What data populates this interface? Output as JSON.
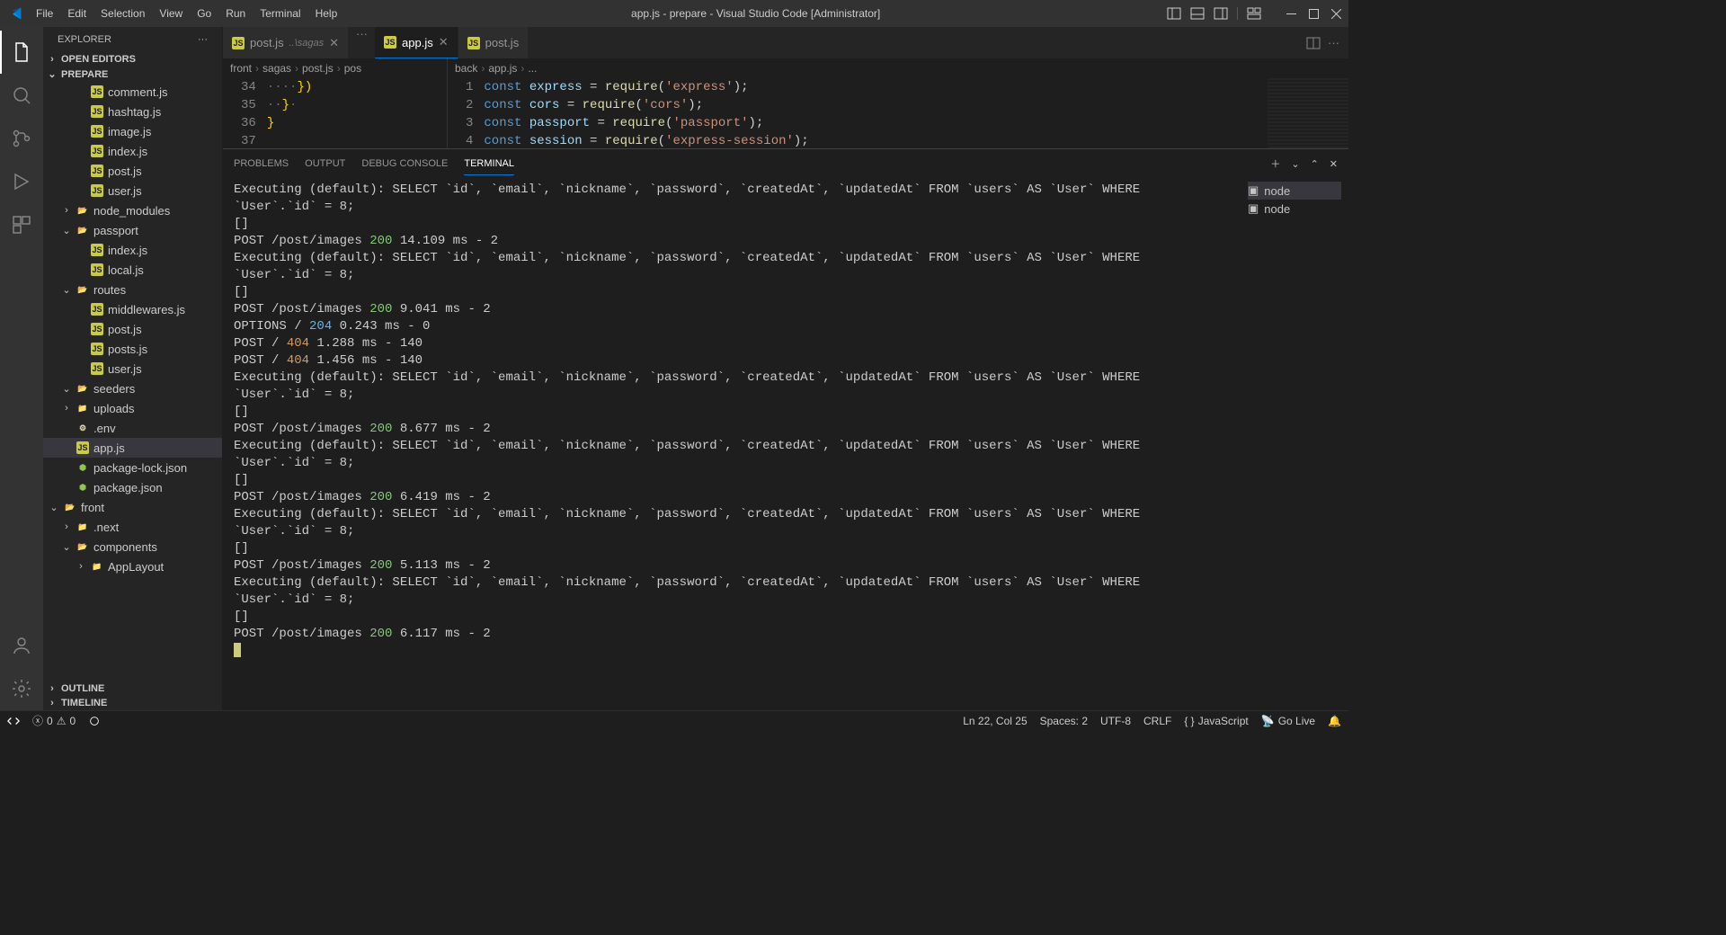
{
  "titlebar": {
    "menu": [
      "File",
      "Edit",
      "Selection",
      "View",
      "Go",
      "Run",
      "Terminal",
      "Help"
    ],
    "title": "app.js - prepare - Visual Studio Code [Administrator]"
  },
  "sidebar": {
    "header": "EXPLORER",
    "openEditors": "OPEN EDITORS",
    "workspace": "PREPARE",
    "files": [
      {
        "name": "comment.js",
        "kind": "js",
        "indent": 2
      },
      {
        "name": "hashtag.js",
        "kind": "js",
        "indent": 2
      },
      {
        "name": "image.js",
        "kind": "js",
        "indent": 2
      },
      {
        "name": "index.js",
        "kind": "js",
        "indent": 2
      },
      {
        "name": "post.js",
        "kind": "js",
        "indent": 2
      },
      {
        "name": "user.js",
        "kind": "js",
        "indent": 2
      },
      {
        "name": "node_modules",
        "kind": "folder-green",
        "indent": 1,
        "chev": "›"
      },
      {
        "name": "passport",
        "kind": "folder-open",
        "indent": 1,
        "chev": "⌄"
      },
      {
        "name": "index.js",
        "kind": "js",
        "indent": 2
      },
      {
        "name": "local.js",
        "kind": "js",
        "indent": 2
      },
      {
        "name": "routes",
        "kind": "folder-green",
        "indent": 1,
        "chev": "⌄"
      },
      {
        "name": "middlewares.js",
        "kind": "js",
        "indent": 2
      },
      {
        "name": "post.js",
        "kind": "js",
        "indent": 2
      },
      {
        "name": "posts.js",
        "kind": "js",
        "indent": 2
      },
      {
        "name": "user.js",
        "kind": "js",
        "indent": 2
      },
      {
        "name": "seeders",
        "kind": "folder-open",
        "indent": 1,
        "chev": "⌄"
      },
      {
        "name": "uploads",
        "kind": "folder",
        "indent": 1,
        "chev": "›"
      },
      {
        "name": ".env",
        "kind": "env",
        "indent": 1
      },
      {
        "name": "app.js",
        "kind": "js",
        "indent": 1,
        "active": true
      },
      {
        "name": "package-lock.json",
        "kind": "node",
        "indent": 1
      },
      {
        "name": "package.json",
        "kind": "node",
        "indent": 1
      },
      {
        "name": "front",
        "kind": "folder-open",
        "indent": 0,
        "chev": "⌄"
      },
      {
        "name": ".next",
        "kind": "folder",
        "indent": 1,
        "chev": "›"
      },
      {
        "name": "components",
        "kind": "folder-green",
        "indent": 1,
        "chev": "⌄"
      },
      {
        "name": "AppLayout",
        "kind": "folder",
        "indent": 2,
        "chev": "›"
      }
    ],
    "outline": "OUTLINE",
    "timeline": "TIMELINE"
  },
  "tabs": {
    "items": [
      {
        "label": "post.js",
        "path": "..\\sagas",
        "active": false,
        "close": true
      },
      {
        "label": "app.js",
        "path": "",
        "active": true,
        "close": true
      },
      {
        "label": "post.js",
        "path": "",
        "active": false,
        "close": false
      }
    ]
  },
  "breadcrumbLeft": [
    "front",
    "sagas",
    "post.js",
    "pos"
  ],
  "breadcrumbRight": [
    "back",
    "app.js",
    "..."
  ],
  "editorLeft": {
    "lines": [
      {
        "n": 34,
        "text": "····})"
      },
      {
        "n": 35,
        "text": "··}·"
      },
      {
        "n": 36,
        "text": "}"
      },
      {
        "n": 37,
        "text": ""
      }
    ]
  },
  "editorRight": {
    "lines": [
      {
        "n": 1,
        "tokens": [
          [
            "kw",
            "const"
          ],
          [
            "pn",
            " "
          ],
          [
            "id",
            "express"
          ],
          [
            "pn",
            " = "
          ],
          [
            "fn",
            "require"
          ],
          [
            "pn",
            "("
          ],
          [
            "str",
            "'express'"
          ],
          [
            "pn",
            ");"
          ]
        ]
      },
      {
        "n": 2,
        "tokens": [
          [
            "kw",
            "const"
          ],
          [
            "pn",
            " "
          ],
          [
            "id",
            "cors"
          ],
          [
            "pn",
            " = "
          ],
          [
            "fn",
            "require"
          ],
          [
            "pn",
            "("
          ],
          [
            "str",
            "'cors'"
          ],
          [
            "pn",
            ");"
          ]
        ]
      },
      {
        "n": 3,
        "tokens": [
          [
            "kw",
            "const"
          ],
          [
            "pn",
            " "
          ],
          [
            "id",
            "passport"
          ],
          [
            "pn",
            " = "
          ],
          [
            "fn",
            "require"
          ],
          [
            "pn",
            "("
          ],
          [
            "str",
            "'passport'"
          ],
          [
            "pn",
            ");"
          ]
        ]
      },
      {
        "n": 4,
        "tokens": [
          [
            "kw",
            "const"
          ],
          [
            "pn",
            " "
          ],
          [
            "id",
            "session"
          ],
          [
            "pn",
            " = "
          ],
          [
            "fn",
            "require"
          ],
          [
            "pn",
            "("
          ],
          [
            "str",
            "'express-session'"
          ],
          [
            "pn",
            ");"
          ]
        ]
      }
    ]
  },
  "panel": {
    "tabs": [
      "PROBLEMS",
      "OUTPUT",
      "DEBUG CONSOLE",
      "TERMINAL"
    ],
    "activeTab": 3,
    "procs": [
      "node",
      "node"
    ]
  },
  "terminal": [
    {
      "t": "Executing (default): SELECT `id`, `email`, `nickname`, `password`, `createdAt`, `updatedAt` FROM `users` AS `User` WHERE `User`.`id` = 8;"
    },
    {
      "t": "[]"
    },
    {
      "t": "POST /post/images ",
      "c": "200",
      "r": " 14.109 ms - 2"
    },
    {
      "t": "Executing (default): SELECT `id`, `email`, `nickname`, `password`, `createdAt`, `updatedAt` FROM `users` AS `User` WHERE `User`.`id` = 8;"
    },
    {
      "t": "[]"
    },
    {
      "t": "POST /post/images ",
      "c": "200",
      "r": " 9.041 ms - 2"
    },
    {
      "t": "OPTIONS / ",
      "c": "204",
      "r": " 0.243 ms - 0"
    },
    {
      "t": "POST / ",
      "c": "404",
      "r": " 1.288 ms - 140"
    },
    {
      "t": "POST / ",
      "c": "404",
      "r": " 1.456 ms - 140"
    },
    {
      "t": "Executing (default): SELECT `id`, `email`, `nickname`, `password`, `createdAt`, `updatedAt` FROM `users` AS `User` WHERE `User`.`id` = 8;"
    },
    {
      "t": "[]"
    },
    {
      "t": "POST /post/images ",
      "c": "200",
      "r": " 8.677 ms - 2"
    },
    {
      "t": "Executing (default): SELECT `id`, `email`, `nickname`, `password`, `createdAt`, `updatedAt` FROM `users` AS `User` WHERE `User`.`id` = 8;"
    },
    {
      "t": "[]"
    },
    {
      "t": "POST /post/images ",
      "c": "200",
      "r": " 6.419 ms - 2"
    },
    {
      "t": "Executing (default): SELECT `id`, `email`, `nickname`, `password`, `createdAt`, `updatedAt` FROM `users` AS `User` WHERE `User`.`id` = 8;"
    },
    {
      "t": "[]"
    },
    {
      "t": "POST /post/images ",
      "c": "200",
      "r": " 5.113 ms - 2"
    },
    {
      "t": "Executing (default): SELECT `id`, `email`, `nickname`, `password`, `createdAt`, `updatedAt` FROM `users` AS `User` WHERE `User`.`id` = 8;"
    },
    {
      "t": "[]"
    },
    {
      "t": "POST /post/images ",
      "c": "200",
      "r": " 6.117 ms - 2"
    }
  ],
  "status": {
    "errors": "0",
    "warnings": "0",
    "lncol": "Ln 22, Col 25",
    "spaces": "Spaces: 2",
    "encoding": "UTF-8",
    "eol": "CRLF",
    "lang": "JavaScript",
    "golive": "Go Live"
  }
}
